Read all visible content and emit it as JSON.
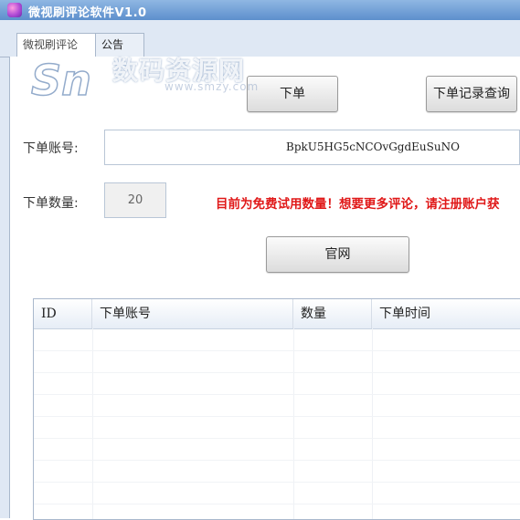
{
  "window": {
    "title": "微视刷评论软件V1.0"
  },
  "tabs": [
    {
      "label": "微视刷评论"
    },
    {
      "label": "公告"
    }
  ],
  "buttons": {
    "order": "下单",
    "query": "下单记录查询",
    "site": "官网"
  },
  "form": {
    "account_label": "下单账号:",
    "account_value": "BpkU5HG5cNCOvGgdEuSuNO",
    "qty_label": "下单数量:",
    "qty_value": "20",
    "notice": "目前为免费试用数量！想要更多评论，请注册账户获"
  },
  "table": {
    "columns": [
      "ID",
      "下单账号",
      "数量",
      "下单时间"
    ],
    "rows": []
  },
  "watermark": {
    "text": "数码资源网",
    "url": "www.smzy.com"
  },
  "colors": {
    "title_bar": "#5d8fcc",
    "notice": "#e01818",
    "window_bg": "#dfe8f4"
  }
}
